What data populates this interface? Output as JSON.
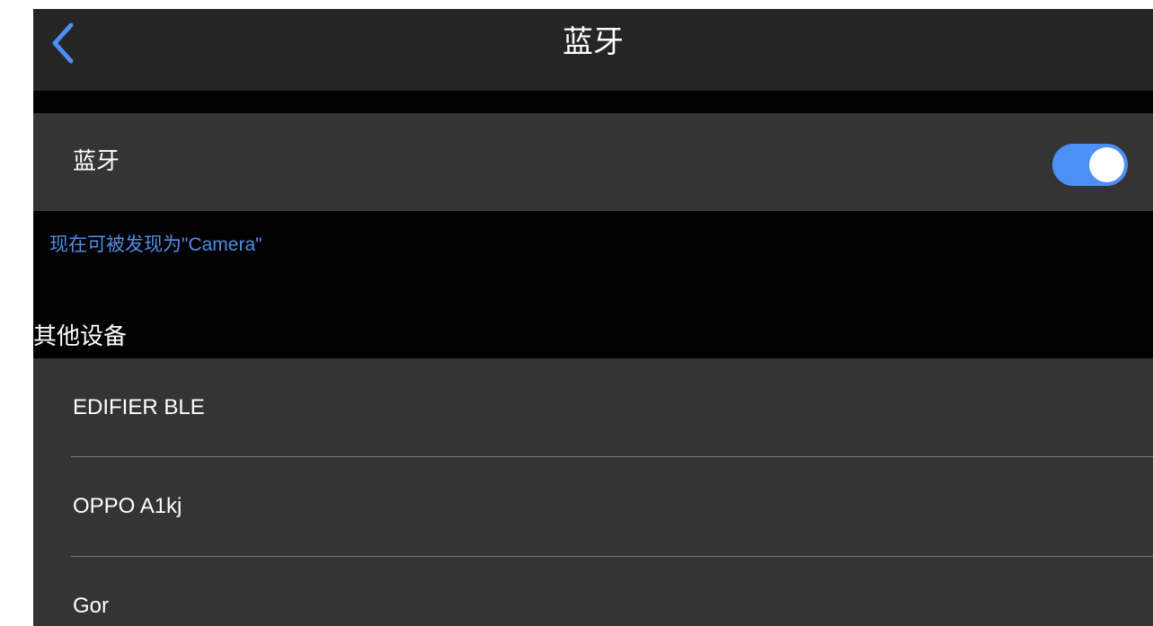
{
  "header": {
    "title": "蓝牙",
    "back_icon": "chevron-left-icon",
    "accent_color": "#4b8ff7"
  },
  "bluetooth": {
    "label": "蓝牙",
    "enabled": true,
    "discoverable_text": "现在可被发现为\"Camera\""
  },
  "other_devices": {
    "title": "其他设备",
    "items": [
      {
        "name": "EDIFIER BLE"
      },
      {
        "name": "OPPO A1kj"
      },
      {
        "name": "Gor"
      }
    ]
  }
}
